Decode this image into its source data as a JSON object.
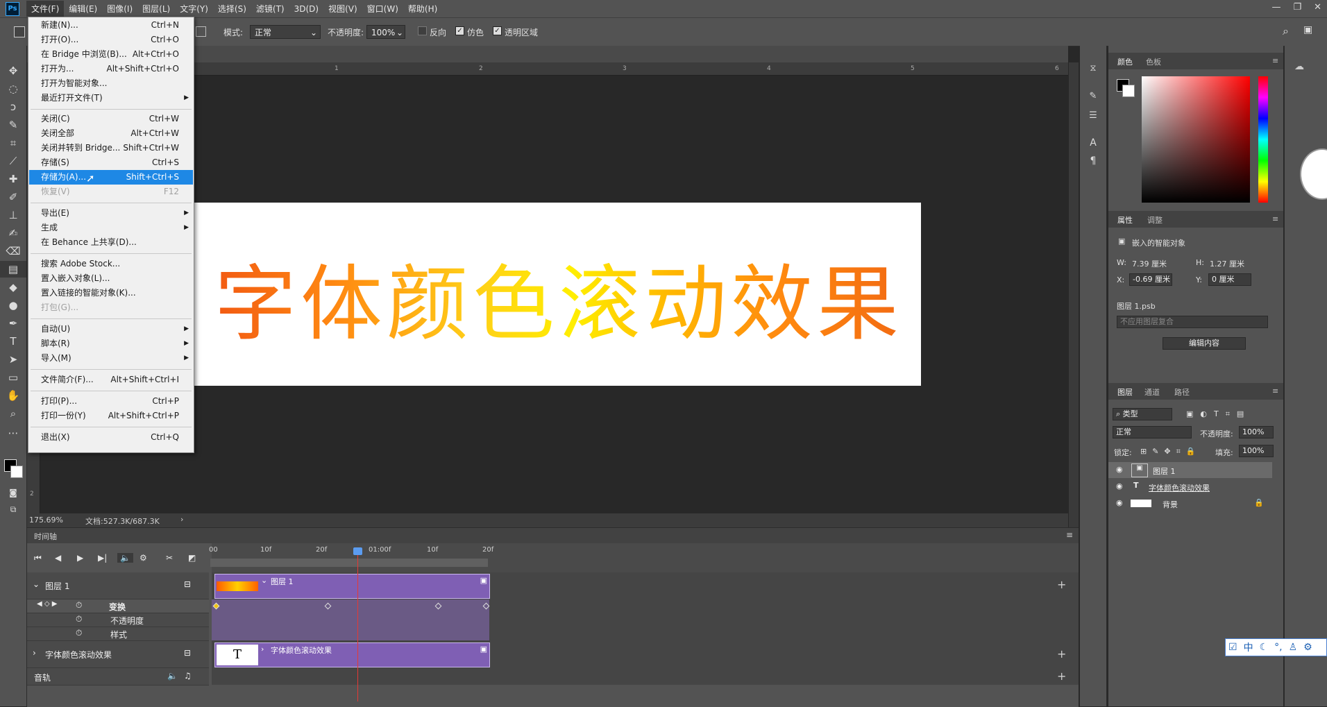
{
  "menubar": {
    "logo": "Ps",
    "items": [
      "文件(F)",
      "编辑(E)",
      "图像(I)",
      "图层(L)",
      "文字(Y)",
      "选择(S)",
      "滤镜(T)",
      "3D(D)",
      "视图(V)",
      "窗口(W)",
      "帮助(H)"
    ]
  },
  "options": {
    "mode_label": "模式:",
    "mode_value": "正常",
    "opacity_label": "不透明度:",
    "opacity_value": "100%",
    "reverse_label": "反向",
    "dither_label": "仿色",
    "transparency_label": "透明区域"
  },
  "file_menu": {
    "items": [
      {
        "label": "新建(N)...",
        "shortcut": "Ctrl+N"
      },
      {
        "label": "打开(O)...",
        "shortcut": "Ctrl+O"
      },
      {
        "label": "在 Bridge 中浏览(B)...",
        "shortcut": "Alt+Ctrl+O"
      },
      {
        "label": "打开为...",
        "shortcut": "Alt+Shift+Ctrl+O"
      },
      {
        "label": "打开为智能对象...",
        "shortcut": ""
      },
      {
        "label": "最近打开文件(T)",
        "shortcut": ""
      },
      {
        "label": "关闭(C)",
        "shortcut": "Ctrl+W"
      },
      {
        "label": "关闭全部",
        "shortcut": "Alt+Ctrl+W"
      },
      {
        "label": "关闭并转到 Bridge...",
        "shortcut": "Shift+Ctrl+W"
      },
      {
        "label": "存储(S)",
        "shortcut": "Ctrl+S"
      },
      {
        "label": "存储为(A)...",
        "shortcut": "Shift+Ctrl+S"
      },
      {
        "label": "恢复(V)",
        "shortcut": "F12"
      },
      {
        "label": "导出(E)",
        "shortcut": ""
      },
      {
        "label": "生成",
        "shortcut": ""
      },
      {
        "label": "在 Behance 上共享(D)...",
        "shortcut": ""
      },
      {
        "label": "搜索 Adobe Stock...",
        "shortcut": ""
      },
      {
        "label": "置入嵌入对象(L)...",
        "shortcut": ""
      },
      {
        "label": "置入链接的智能对象(K)...",
        "shortcut": ""
      },
      {
        "label": "打包(G)...",
        "shortcut": ""
      },
      {
        "label": "自动(U)",
        "shortcut": ""
      },
      {
        "label": "脚本(R)",
        "shortcut": ""
      },
      {
        "label": "导入(M)",
        "shortcut": ""
      },
      {
        "label": "文件简介(F)...",
        "shortcut": "Alt+Shift+Ctrl+I"
      },
      {
        "label": "打印(P)...",
        "shortcut": "Ctrl+P"
      },
      {
        "label": "打印一份(Y)",
        "shortcut": "Alt+Shift+Ctrl+P"
      },
      {
        "label": "退出(X)",
        "shortcut": "Ctrl+Q"
      }
    ]
  },
  "rulers": {
    "h": [
      "1",
      "2",
      "3",
      "4",
      "5",
      "6"
    ],
    "v": [
      "2"
    ]
  },
  "canvas": {
    "text": "字体颜色滚动效果"
  },
  "status": {
    "zoom": "175.69%",
    "doc": "文档:527.3K/687.3K"
  },
  "color_panel": {
    "tabs": [
      "颜色",
      "色板"
    ]
  },
  "properties": {
    "tabs": [
      "属性",
      "调整"
    ],
    "type_label": "嵌入的智能对象",
    "w_label": "W:",
    "w_value": "7.39 厘米",
    "h_label": "H:",
    "h_value": "1.27 厘米",
    "x_label": "X:",
    "x_value": "-0.69 厘米",
    "y_label": "Y:",
    "y_value": "0 厘米",
    "file": "图层 1.psb",
    "comp": "不应用图层复合",
    "edit_button": "编辑内容"
  },
  "layers_panel": {
    "tabs": [
      "图层",
      "通道",
      "路径"
    ],
    "filter": "类型",
    "blend": "正常",
    "opacity_label": "不透明度:",
    "opacity_value": "100%",
    "lock_label": "锁定:",
    "fill_label": "填充:",
    "fill_value": "100%",
    "layers": [
      "图层 1",
      "字体颜色滚动效果",
      "背景"
    ]
  },
  "timeline": {
    "title": "时间轴",
    "ruler": [
      "00",
      "10f",
      "20f",
      "01:00f",
      "10f",
      "20f"
    ],
    "track1": "图层 1",
    "prop_transform": "变换",
    "prop_opacity": "不透明度",
    "prop_style": "样式",
    "track2": "字体颜色滚动效果",
    "audio": "音轨",
    "clip1_title": "图层 1",
    "clip2_title": "字体颜色滚动效果"
  },
  "ime": {
    "mode": "中"
  }
}
